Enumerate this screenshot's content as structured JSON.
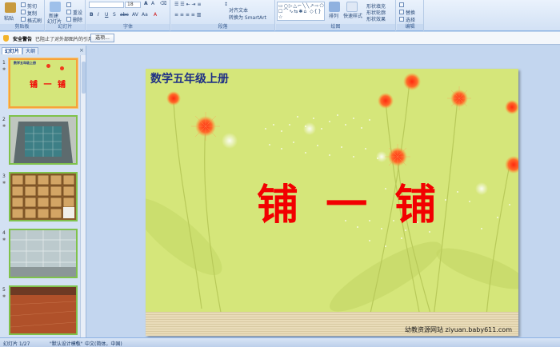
{
  "ribbon": {
    "groups": [
      {
        "name": "剪贴板"
      },
      {
        "name": "幻灯片"
      },
      {
        "name": "字体"
      },
      {
        "name": "段落"
      },
      {
        "name": "绘图"
      },
      {
        "name": "编辑"
      }
    ],
    "paste": "粘贴",
    "cut": "剪切",
    "copy": "复制",
    "format_painter": "格式刷",
    "new_slide": "新建",
    "new_slide2": "幻灯片",
    "reset": "重设",
    "delete": "删除",
    "font_size": "18",
    "align_text": "对齐文本",
    "smartart": "转换为 SmartArt",
    "arrange": "排列",
    "quick_styles": "快速样式",
    "shape_fill": "形状填充",
    "shape_outline": "形状轮廓",
    "shape_effects": "形状效果",
    "replace": "替换",
    "select": "选择"
  },
  "security": {
    "title": "安全警告",
    "message": "已阻止了对外部图片的引用",
    "options_button": "选项..."
  },
  "pane": {
    "tab_slides": "幻灯片",
    "tab_outline": "大纲",
    "close": "×",
    "slides": [
      {
        "num": "1",
        "title": "铺 一 铺",
        "subtitle": "数学五年级上册"
      },
      {
        "num": "2"
      },
      {
        "num": "3"
      },
      {
        "num": "4"
      },
      {
        "num": "5"
      }
    ]
  },
  "slide": {
    "subtitle": "数学五年级上册",
    "title": "铺 一 铺",
    "credit": "幼教资源网站  ziyuan.baby611.com"
  },
  "status": {
    "slide_count": "幻灯片 1/27",
    "theme": "\"默认设计模板\"",
    "language": "中文(简体，中国)"
  },
  "colors": {
    "slide_bg": "#d5e67a",
    "title_red": "#f20000",
    "subtitle_blue": "#1e2f86",
    "selected_thumb": "#f7a23b",
    "thumb_border": "#7fc24b"
  }
}
